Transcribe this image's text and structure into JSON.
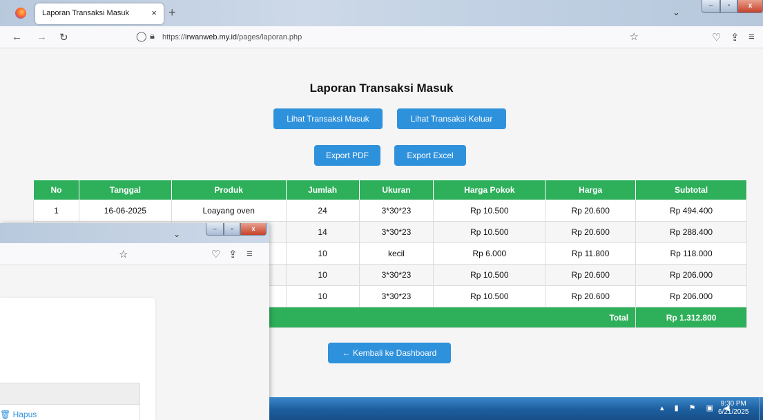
{
  "browser": {
    "tab_title": "Laporan Transaksi Masuk",
    "tab_close": "×",
    "new_tab": "+",
    "tabs_list": "⌄",
    "url_prefix": "https://",
    "url_host": "irwanweb.my.id",
    "url_path": "/pages/laporan.php",
    "win_min": "–",
    "win_max": "▫",
    "win_close": "x"
  },
  "page": {
    "title": "Laporan Transaksi Masuk",
    "buttons": {
      "masuk": "Lihat Transaksi Masuk",
      "keluar": "Lihat Transaksi Keluar",
      "pdf": "Export PDF",
      "excel": "Export Excel",
      "back": "← Kembali ke Dashboard"
    },
    "table": {
      "headers": [
        "No",
        "Tanggal",
        "Produk",
        "Jumlah",
        "Ukuran",
        "Harga Pokok",
        "Harga",
        "Subtotal"
      ],
      "rows": [
        [
          "1",
          "16-06-2025",
          "Loayang oven",
          "24",
          "3*30*23",
          "Rp 10.500",
          "Rp 20.600",
          "Rp 494.400"
        ],
        [
          "",
          "",
          "",
          "14",
          "3*30*23",
          "Rp 10.500",
          "Rp 20.600",
          "Rp 288.400"
        ],
        [
          "",
          "",
          "",
          "10",
          "kecil",
          "Rp 6.000",
          "Rp 11.800",
          "Rp 118.000"
        ],
        [
          "",
          "",
          "",
          "10",
          "3*30*23",
          "Rp 10.500",
          "Rp 20.600",
          "Rp 206.000"
        ],
        [
          "",
          "",
          "",
          "10",
          "3*30*23",
          "Rp 10.500",
          "Rp 20.600",
          "Rp 206.000"
        ]
      ],
      "total_label": "Total",
      "total_value": "Rp 1.312.800"
    }
  },
  "second_window": {
    "tabs_list": "⌄",
    "win_min": "–",
    "win_max": "▫",
    "win_close": "x",
    "hapus": "🗑 Hapus"
  },
  "taskbar": {
    "time": "9:30 PM",
    "date": "6/21/2025",
    "tray": "▴ ▮ ⚑ ▣ ◀"
  }
}
